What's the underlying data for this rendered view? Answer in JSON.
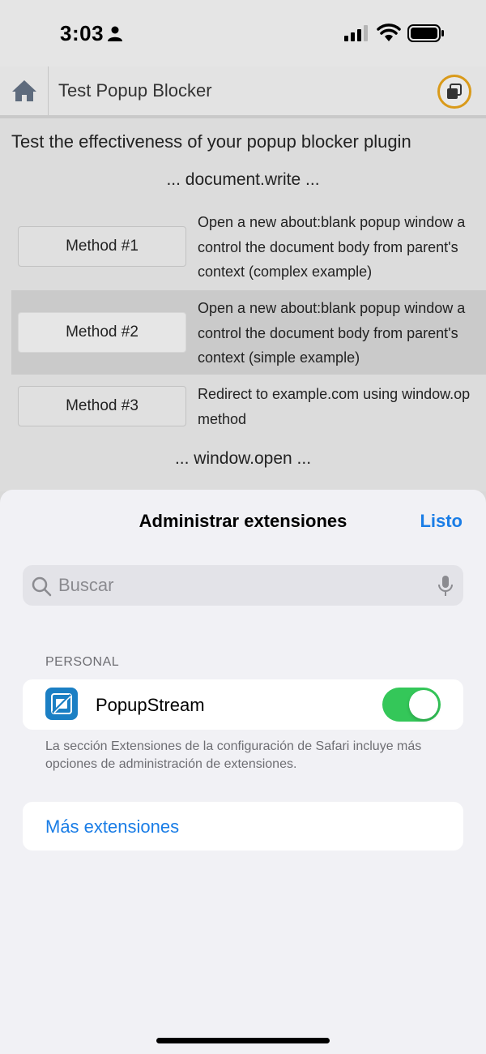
{
  "status_bar": {
    "time": "3:03"
  },
  "web": {
    "header_title": "Test Popup Blocker",
    "intro": "Test the effectiveness of your popup blocker plugin",
    "section_document_write": "... document.write ...",
    "section_window_open": "... window.open ...",
    "methods": [
      {
        "label": "Method #1",
        "desc_lines": [
          "Open a new about:blank popup window a",
          "control the document body from parent's",
          "context (complex example)"
        ]
      },
      {
        "label": "Method #2",
        "desc_lines": [
          "Open a new about:blank popup window a",
          "control the document body from parent's",
          "context (simple example)"
        ]
      },
      {
        "label": "Method #3",
        "desc_lines": [
          "Redirect to example.com using window.op",
          "method"
        ]
      }
    ]
  },
  "sheet": {
    "title": "Administrar extensiones",
    "done_label": "Listo",
    "search_placeholder": "Buscar",
    "section_header": "PERSONAL",
    "extension": {
      "name": "PopupStream",
      "enabled": true
    },
    "footer_note": "La sección Extensiones de la configuración de Safari incluye más opciones de administración de extensiones.",
    "more_extensions": "Más extensiones"
  },
  "colors": {
    "accent": "#1a7de6",
    "toggle_on": "#34c759",
    "extension_icon": "#1b7fc4",
    "highlight_ring": "#d99a1a"
  },
  "icons": [
    "person-icon",
    "signal-icon",
    "wifi-icon",
    "battery-icon",
    "home-icon",
    "popup-windows-icon",
    "search-icon",
    "mic-icon",
    "popupstream-icon"
  ]
}
